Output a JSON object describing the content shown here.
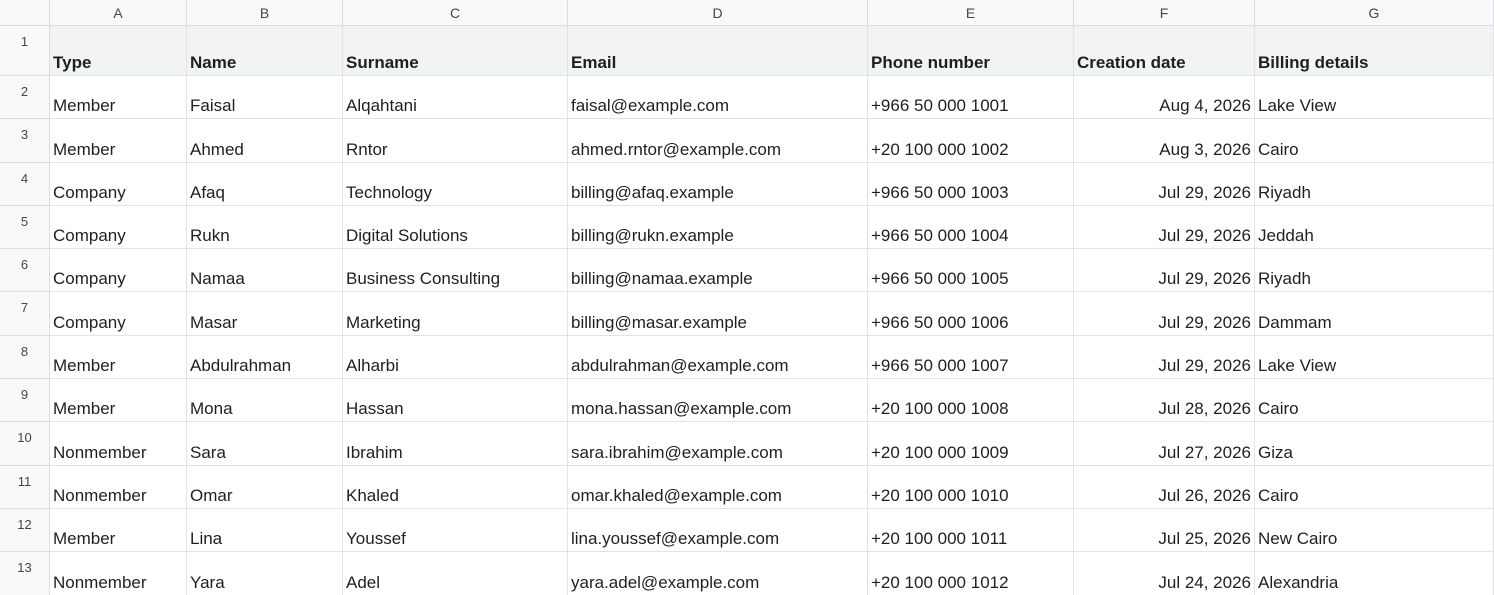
{
  "columns": [
    "A",
    "B",
    "C",
    "D",
    "E",
    "F",
    "G"
  ],
  "header": {
    "row_number": "1",
    "labels": [
      "Type",
      "Name",
      "Surname",
      "Email",
      "Phone number",
      "Creation date",
      "Billing details"
    ]
  },
  "rows": [
    {
      "n": "2",
      "cells": [
        "Member",
        "Faisal",
        "Alqahtani",
        "faisal@example.com",
        "+966 50 000 1001",
        "Aug 4, 2026",
        "Lake View"
      ]
    },
    {
      "n": "3",
      "cells": [
        "Member",
        "Ahmed",
        "Rntor",
        "ahmed.rntor@example.com",
        "+20 100 000 1002",
        "Aug 3, 2026",
        "Cairo"
      ]
    },
    {
      "n": "4",
      "cells": [
        "Company",
        "Afaq",
        "Technology",
        "billing@afaq.example",
        "+966 50 000 1003",
        "Jul 29, 2026",
        "Riyadh"
      ]
    },
    {
      "n": "5",
      "cells": [
        "Company",
        "Rukn",
        "Digital Solutions",
        "billing@rukn.example",
        "+966 50 000 1004",
        "Jul 29, 2026",
        "Jeddah"
      ]
    },
    {
      "n": "6",
      "cells": [
        "Company",
        "Namaa",
        "Business Consulting",
        "billing@namaa.example",
        "+966 50 000 1005",
        "Jul 29, 2026",
        "Riyadh"
      ]
    },
    {
      "n": "7",
      "cells": [
        "Company",
        "Masar",
        "Marketing",
        "billing@masar.example",
        "+966 50 000 1006",
        "Jul 29, 2026",
        "Dammam"
      ]
    },
    {
      "n": "8",
      "cells": [
        "Member",
        "Abdulrahman",
        "Alharbi",
        "abdulrahman@example.com",
        "+966 50 000 1007",
        "Jul 29, 2026",
        "Lake View"
      ]
    },
    {
      "n": "9",
      "cells": [
        "Member",
        "Mona",
        "Hassan",
        "mona.hassan@example.com",
        "+20 100 000 1008",
        "Jul 28, 2026",
        "Cairo"
      ]
    },
    {
      "n": "10",
      "cells": [
        "Nonmember",
        "Sara",
        "Ibrahim",
        "sara.ibrahim@example.com",
        "+20 100 000 1009",
        "Jul 27, 2026",
        "Giza"
      ]
    },
    {
      "n": "11",
      "cells": [
        "Nonmember",
        "Omar",
        "Khaled",
        "omar.khaled@example.com",
        "+20 100 000 1010",
        "Jul 26, 2026",
        "Cairo"
      ]
    },
    {
      "n": "12",
      "cells": [
        "Member",
        "Lina",
        "Youssef",
        "lina.youssef@example.com",
        "+20 100 000 1011",
        "Jul 25, 2026",
        "New Cairo"
      ]
    },
    {
      "n": "13",
      "cells": [
        "Nonmember",
        "Yara",
        "Adel",
        "yara.adel@example.com",
        "+20 100 000 1012",
        "Jul 24, 2026",
        "Alexandria"
      ]
    }
  ]
}
